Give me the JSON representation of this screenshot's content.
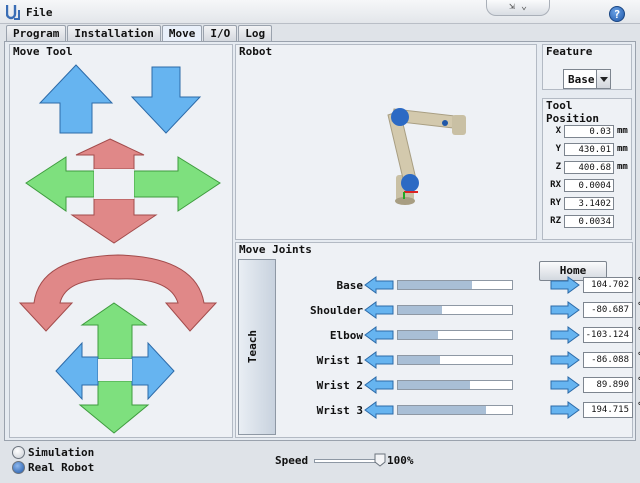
{
  "app": {
    "file_menu": "File",
    "help_icon": "help-icon",
    "help_label": "?",
    "window_controls_label": "⇲ ⌄"
  },
  "tabs": [
    {
      "label": "Program",
      "active": false
    },
    {
      "label": "Installation",
      "active": false
    },
    {
      "label": "Move",
      "active": true
    },
    {
      "label": "I/O",
      "active": false
    },
    {
      "label": "Log",
      "active": false
    }
  ],
  "move_tool": {
    "title": "Move Tool"
  },
  "robot": {
    "title": "Robot"
  },
  "feature": {
    "title": "Feature",
    "selected": "Base"
  },
  "tool_position": {
    "title": "Tool Position",
    "rows": [
      {
        "label": "X",
        "value": "0.03",
        "unit": "mm"
      },
      {
        "label": "Y",
        "value": "430.01",
        "unit": "mm"
      },
      {
        "label": "Z",
        "value": "400.68",
        "unit": "mm"
      },
      {
        "label": "RX",
        "value": "0.0004",
        "unit": ""
      },
      {
        "label": "RY",
        "value": "3.1402",
        "unit": ""
      },
      {
        "label": "RZ",
        "value": "0.0034",
        "unit": ""
      }
    ]
  },
  "move_joints": {
    "title": "Move Joints",
    "teach_label": "Teach",
    "home_label": "Home",
    "joints": [
      {
        "label": "Base",
        "value": "104.702",
        "unit": "°",
        "level": 0.65
      },
      {
        "label": "Shoulder",
        "value": "-80.687",
        "unit": "°",
        "level": 0.39
      },
      {
        "label": "Elbow",
        "value": "-103.124",
        "unit": "°",
        "level": 0.35
      },
      {
        "label": "Wrist 1",
        "value": "-86.088",
        "unit": "°",
        "level": 0.37
      },
      {
        "label": "Wrist 2",
        "value": "89.890",
        "unit": "°",
        "level": 0.63
      },
      {
        "label": "Wrist 3",
        "value": "194.715",
        "unit": "°",
        "level": 0.77
      }
    ]
  },
  "mode": {
    "simulation": "Simulation",
    "real_robot": "Real Robot",
    "selected": "real_robot"
  },
  "speed": {
    "label": "Speed",
    "value": "100%",
    "level": 1.0
  },
  "colors": {
    "blue_arrow": "#66b4f0",
    "green_arrow": "#7ee07e",
    "red_arrow": "#e08888",
    "joint_fill": "#a9bfd6"
  }
}
